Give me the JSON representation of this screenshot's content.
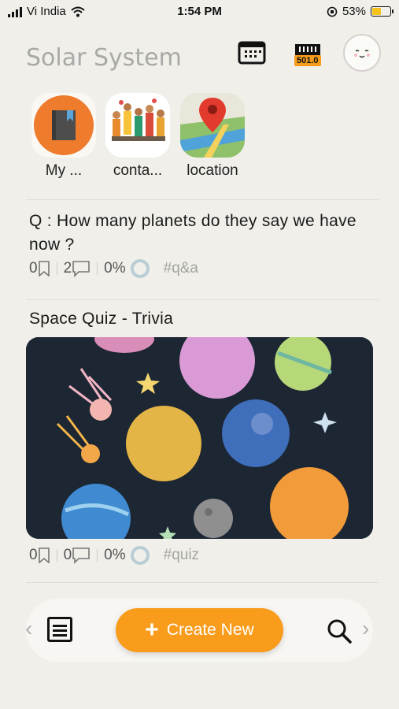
{
  "status_bar": {
    "carrier": "Vi India",
    "time": "1:54 PM",
    "battery": "53%",
    "battery_level": 0.53
  },
  "header": {
    "title": "Solar System",
    "counter_badge": "501.0"
  },
  "categories": [
    {
      "label": "My ...",
      "icon": "book-icon"
    },
    {
      "label": "conta...",
      "icon": "people-icon"
    },
    {
      "label": "location",
      "icon": "map-pin-icon"
    }
  ],
  "posts": [
    {
      "text": "Q : How many planets do they say we have now ?",
      "bookmarks": "0",
      "comments": "2",
      "percent": "0%",
      "tag": "#q&a"
    },
    {
      "title": "Space Quiz - Trivia",
      "bookmarks": "0",
      "comments": "0",
      "percent": "0%",
      "tag": "#quiz"
    }
  ],
  "bottom_bar": {
    "create_label": "Create New"
  },
  "colors": {
    "accent": "#f99c1c",
    "background": "#f0efea"
  }
}
